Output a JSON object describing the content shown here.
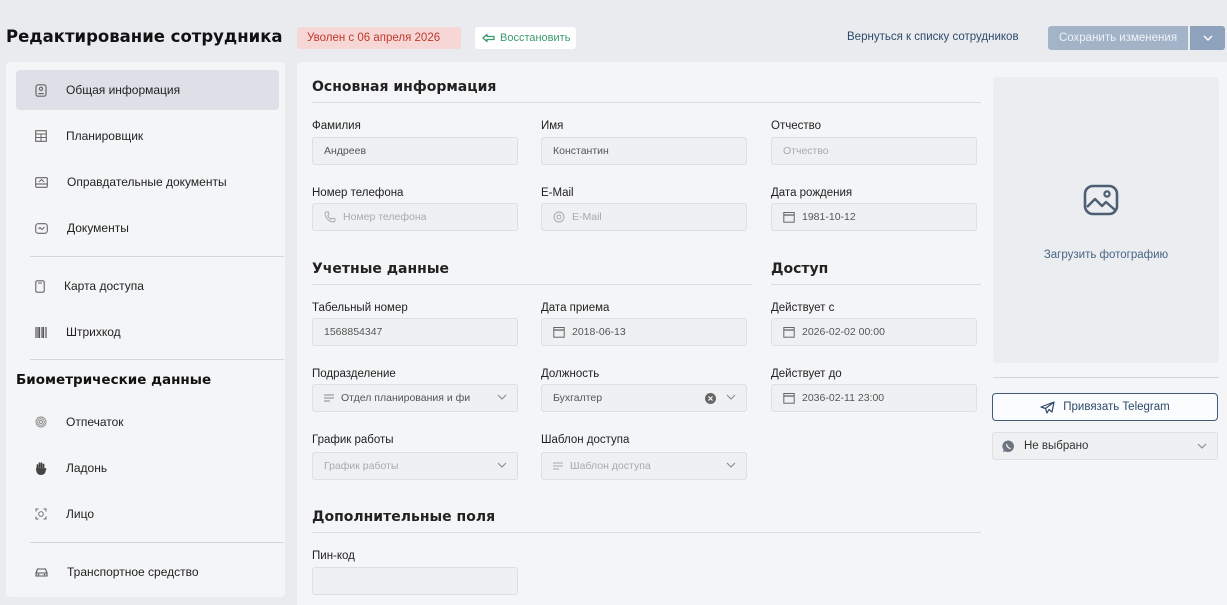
{
  "header": {
    "title": "Редактирование сотрудника",
    "status": "Уволен с 06 апреля 2026",
    "restore_label": "Восстановить",
    "back_label": "Вернуться к списку сотрудников",
    "save_label": "Сохранить изменения"
  },
  "sidebar": {
    "items": [
      {
        "label": "Общая информация",
        "icon": "user-card-icon"
      },
      {
        "label": "Планировщик",
        "icon": "calendar-grid-icon"
      },
      {
        "label": "Оправдательные документы",
        "icon": "document-tray-icon"
      },
      {
        "label": "Документы",
        "icon": "id-card-icon"
      },
      {
        "label": "Карта доступа",
        "icon": "access-card-icon"
      },
      {
        "label": "Штрихкод",
        "icon": "barcode-icon"
      },
      {
        "label": "Отпечаток",
        "icon": "fingerprint-icon"
      },
      {
        "label": "Ладонь",
        "icon": "palm-icon"
      },
      {
        "label": "Лицо",
        "icon": "face-scan-icon"
      },
      {
        "label": "Транспортное средство",
        "icon": "car-icon"
      }
    ],
    "biometrics_heading": "Биометрические данные"
  },
  "main": {
    "basic_title": "Основная информация",
    "accounts_title": "Учетные данные",
    "access_title": "Доступ",
    "extra_title": "Дополнительные поля",
    "fields": {
      "last_name": {
        "label": "Фамилия",
        "value": "Андреев"
      },
      "first_name": {
        "label": "Имя",
        "value": "Константин"
      },
      "middle_name": {
        "label": "Отчество",
        "placeholder": "Отчество"
      },
      "phone": {
        "label": "Номер телефона",
        "placeholder": "Номер телефона"
      },
      "email": {
        "label": "E-Mail",
        "placeholder": "E-Mail"
      },
      "birth_date": {
        "label": "Дата рождения",
        "value": "1981-10-12"
      },
      "tab_number": {
        "label": "Табельный номер",
        "value": "1568854347"
      },
      "hire_date": {
        "label": "Дата приема",
        "value": "2018-06-13"
      },
      "valid_from": {
        "label": "Действует с",
        "value": "2026-02-02 00:00"
      },
      "department": {
        "label": "Подразделение",
        "value": "Отдел планирования и фи"
      },
      "position": {
        "label": "Должность",
        "value": "Бухгалтер"
      },
      "valid_to": {
        "label": "Действует до",
        "value": "2036-02-11 23:00"
      },
      "schedule": {
        "label": "График работы",
        "placeholder": "График работы"
      },
      "access_template": {
        "label": "Шаблон доступа",
        "placeholder": "Шаблон доступа"
      },
      "pin": {
        "label": "Пин-код",
        "value": ""
      }
    },
    "photo_label": "Загрузить фотографию",
    "telegram_label": "Привязать Telegram",
    "messenger_value": "Не выбрано"
  }
}
